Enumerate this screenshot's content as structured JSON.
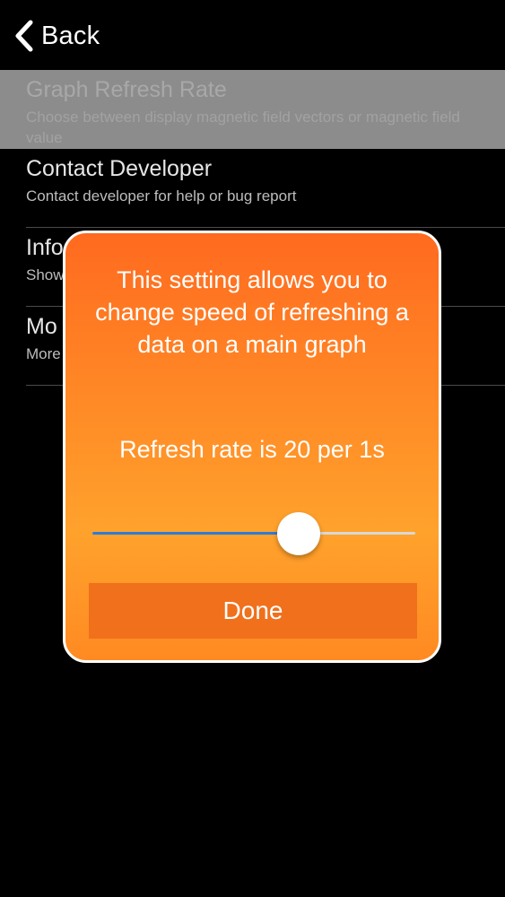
{
  "nav": {
    "back_label": "Back"
  },
  "settings": {
    "items": [
      {
        "title": "Graph Refresh Rate",
        "subtitle": "Choose between display magnetic field vectors or magnetic field value"
      },
      {
        "title": "Contact Developer",
        "subtitle": "Contact developer for help or bug report"
      },
      {
        "title": "Info",
        "subtitle": "Show"
      },
      {
        "title": "Mo",
        "subtitle": "More"
      }
    ]
  },
  "dialog": {
    "message": "This setting allows you to change speed of refreshing a data on a main graph",
    "rate_label": "Refresh rate is 20 per 1s",
    "slider": {
      "value_fraction": 0.64
    },
    "done_label": "Done"
  },
  "colors": {
    "dialog_orange": "#ff8a26",
    "done_button": "#f0701c",
    "slider_fill": "#2f7bd6",
    "selected_row": "#8c8c8c"
  }
}
